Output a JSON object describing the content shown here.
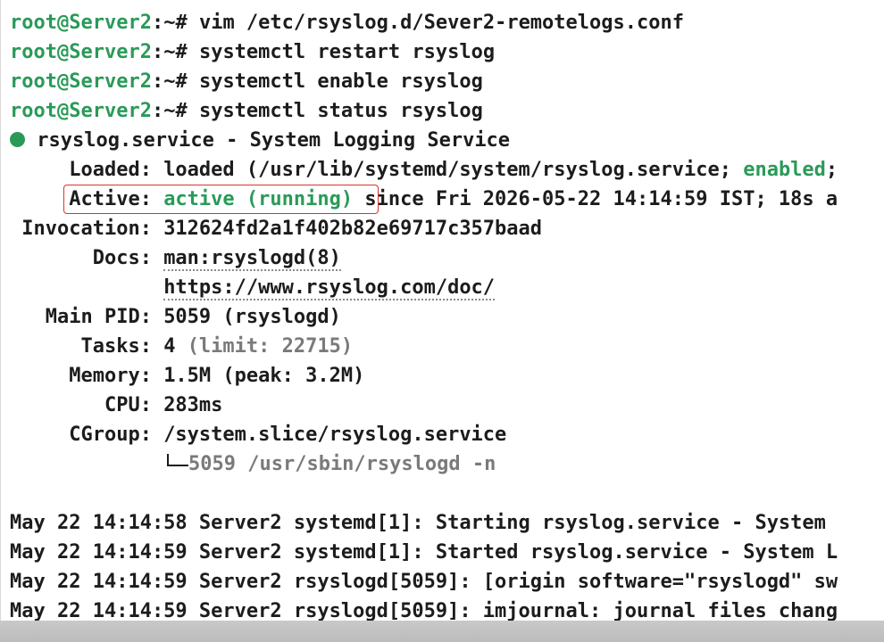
{
  "prompt": {
    "user_host": "root@Server2",
    "path_suffix": ":~#"
  },
  "commands": [
    " vim /etc/rsyslog.d/Sever2-remotelogs.conf",
    " systemctl restart rsyslog",
    " systemctl enable rsyslog",
    " systemctl status rsyslog"
  ],
  "status": {
    "unit_line": " rsyslog.service - System Logging Service",
    "loaded_label": "     Loaded: ",
    "loaded_value": "loaded (/usr/lib/systemd/system/rsyslog.service; ",
    "loaded_enabled": "enabled",
    "loaded_tail": ";",
    "active_label": "     Active: ",
    "active_value": "active (running)",
    "active_tail": " since Fri 2026-05-22 14:14:59 IST; 18s a",
    "invocation_label": " Invocation: ",
    "invocation_value": "312624fd2a1f402b82e69717c357baad",
    "docs_label": "       Docs: ",
    "docs_value_1": "man:rsyslogd(8)",
    "docs_value_2": "https://www.rsyslog.com/doc/",
    "mainpid_label": "   Main PID: ",
    "mainpid_value": "5059 (rsyslogd)",
    "tasks_label": "      Tasks: ",
    "tasks_value": "4 ",
    "tasks_limit": "(limit: 22715)",
    "memory_label": "     Memory: ",
    "memory_value": "1.5M (peak: 3.2M)",
    "cpu_label": "        CPU: ",
    "cpu_value": "283ms",
    "cgroup_label": "     CGroup: ",
    "cgroup_value": "/system.slice/rsyslog.service",
    "cgroup_child": "5059 /usr/sbin/rsyslogd -n"
  },
  "logs": [
    "May 22 14:14:58 Server2 systemd[1]: Starting rsyslog.service - System",
    "May 22 14:14:59 Server2 systemd[1]: Started rsyslog.service - System L",
    "May 22 14:14:59 Server2 rsyslogd[5059]: [origin software=\"rsyslogd\" sw",
    "May 22 14:14:59 Server2 rsyslogd[5059]: imjournal: journal files chang"
  ],
  "colors": {
    "prompt_green": "#2a9a58",
    "highlight_red": "#d9342b",
    "dim_gray": "#7a7a7a"
  }
}
